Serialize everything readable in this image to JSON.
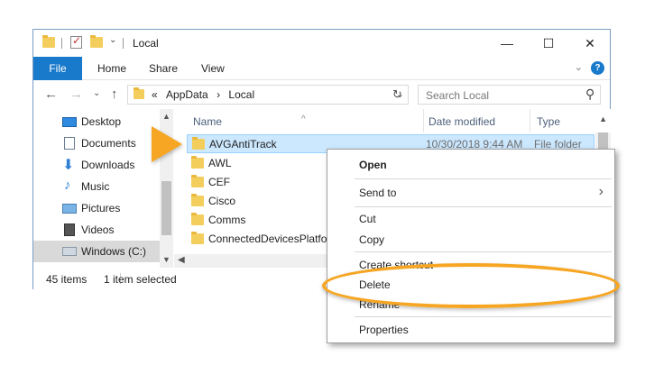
{
  "window": {
    "title": "Local",
    "controls": {
      "minimize": "—",
      "maximize": "☐",
      "close": "✕"
    }
  },
  "ribbon": {
    "tabs": [
      "File",
      "Home",
      "Share",
      "View"
    ],
    "collapse_icon": "chevron-down-icon",
    "help_icon": "?"
  },
  "address": {
    "back": "←",
    "forward": "→",
    "dropdown": "⌄",
    "up": "↑",
    "prefix": "«",
    "path": [
      "AppData",
      "Local"
    ],
    "path_sep": "›",
    "refresh": "↻",
    "search_placeholder": "Search Local",
    "search_icon": "⚲"
  },
  "sidebar": {
    "items": [
      {
        "label": "Desktop",
        "icon": "desktop-icon"
      },
      {
        "label": "Documents",
        "icon": "documents-icon"
      },
      {
        "label": "Downloads",
        "icon": "downloads-icon"
      },
      {
        "label": "Music",
        "icon": "music-icon"
      },
      {
        "label": "Pictures",
        "icon": "pictures-icon"
      },
      {
        "label": "Videos",
        "icon": "videos-icon"
      },
      {
        "label": "Windows (C:)",
        "icon": "drive-icon",
        "selected": true
      }
    ],
    "up_arrow": "▲",
    "down_arrow": "▼"
  },
  "filelist": {
    "columns": {
      "name": "Name",
      "date": "Date modified",
      "type": "Type"
    },
    "sort_indicator": "^",
    "rows": [
      {
        "name": "AVGAntiTrack",
        "date": "10/30/2018 9:44 AM",
        "type": "File folder",
        "selected": true
      },
      {
        "name": "AWL"
      },
      {
        "name": "CEF"
      },
      {
        "name": "Cisco"
      },
      {
        "name": "Comms"
      },
      {
        "name": "ConnectedDevicesPlatfo"
      }
    ],
    "up_arrow": "▲",
    "left_arrow": "◀"
  },
  "status": {
    "items_count": "45 items",
    "selection": "1 item selected"
  },
  "context_menu": {
    "open": "Open",
    "send_to": "Send to",
    "submenu_arrow": "›",
    "cut": "Cut",
    "copy": "Copy",
    "create_shortcut": "Create shortcut",
    "delete": "Delete",
    "rename": "Rename",
    "properties": "Properties"
  },
  "colors": {
    "accent": "#1979ca",
    "highlight": "#f6a623",
    "selection": "#cce8ff"
  }
}
